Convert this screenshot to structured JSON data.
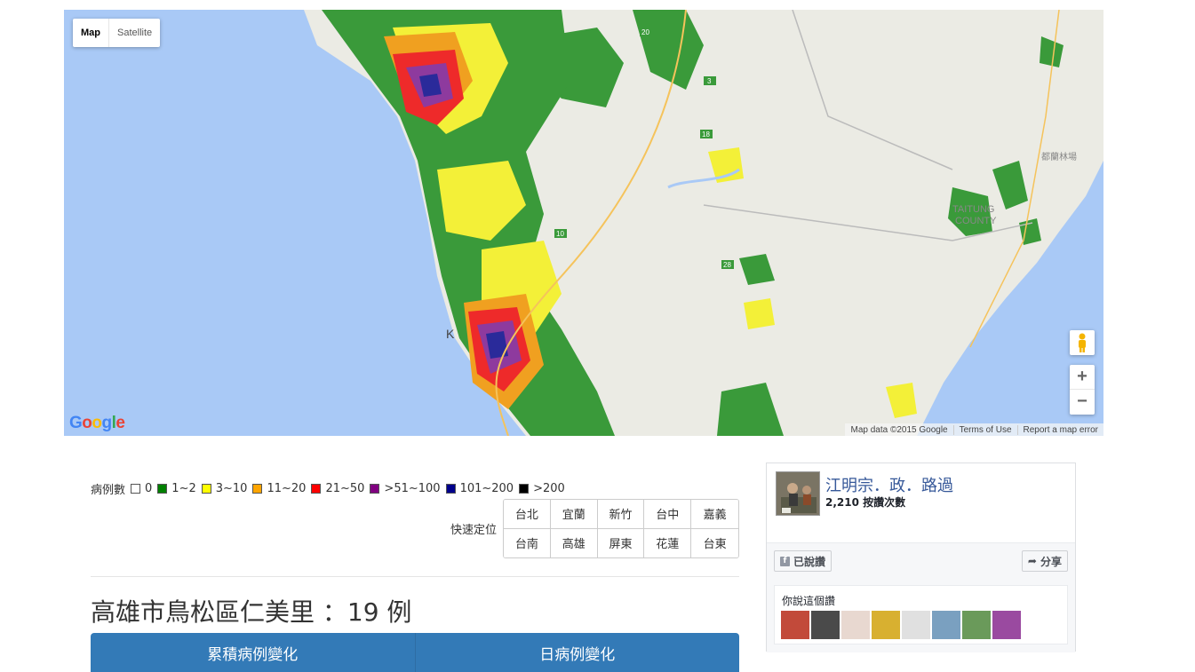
{
  "map": {
    "type_buttons": [
      "Map",
      "Satellite"
    ],
    "place_labels": {
      "taitung": "TAITUNG",
      "taitung2": "COUNTY",
      "forest": "都蘭林場",
      "kaohsiung": "K"
    },
    "route_labels": [
      "20",
      "10",
      "3",
      "18",
      "28"
    ],
    "attribution": [
      "Map data ©2015 Google",
      "Terms of Use",
      "Report a map error"
    ],
    "zoom_in": "+",
    "zoom_out": "−",
    "logo": "Google",
    "colors": {
      "sea": "#a9c9f6",
      "land": "#ebebe4",
      "green": "#3a9a3a",
      "yellow": "#f3f038",
      "orange": "#f0a020",
      "red": "#ee2a2a",
      "purple": "#8e3a9e",
      "blue": "#2a2a9a"
    }
  },
  "legend": {
    "title": "病例數",
    "items": [
      {
        "label": "0",
        "color": "#ffffff"
      },
      {
        "label": "1~2",
        "color": "#008000"
      },
      {
        "label": "3~10",
        "color": "#ffff00"
      },
      {
        "label": "11~20",
        "color": "#ffa500"
      },
      {
        "label": "21~50",
        "color": "#ff0000"
      },
      {
        "label": ">51~100",
        "color": "#800080"
      },
      {
        "label": "101~200",
        "color": "#00008b"
      },
      {
        "label": ">200",
        "color": "#000000"
      }
    ]
  },
  "quick_locate": {
    "label": "快速定位",
    "cities": [
      "台北",
      "宜蘭",
      "新竹",
      "台中",
      "嘉義",
      "台南",
      "高雄",
      "屏東",
      "花蓮",
      "台東"
    ]
  },
  "selected": {
    "heading": "高雄市鳥松區仁美里 ：19 例"
  },
  "tabs": [
    "累積病例變化",
    "日病例變化"
  ],
  "facebook": {
    "page_name": "江明宗．政．路過",
    "like_count": "2,210 按讚次數",
    "liked_label": "已說讚",
    "share_label": "分享",
    "friends_label": "你說這個讚"
  }
}
